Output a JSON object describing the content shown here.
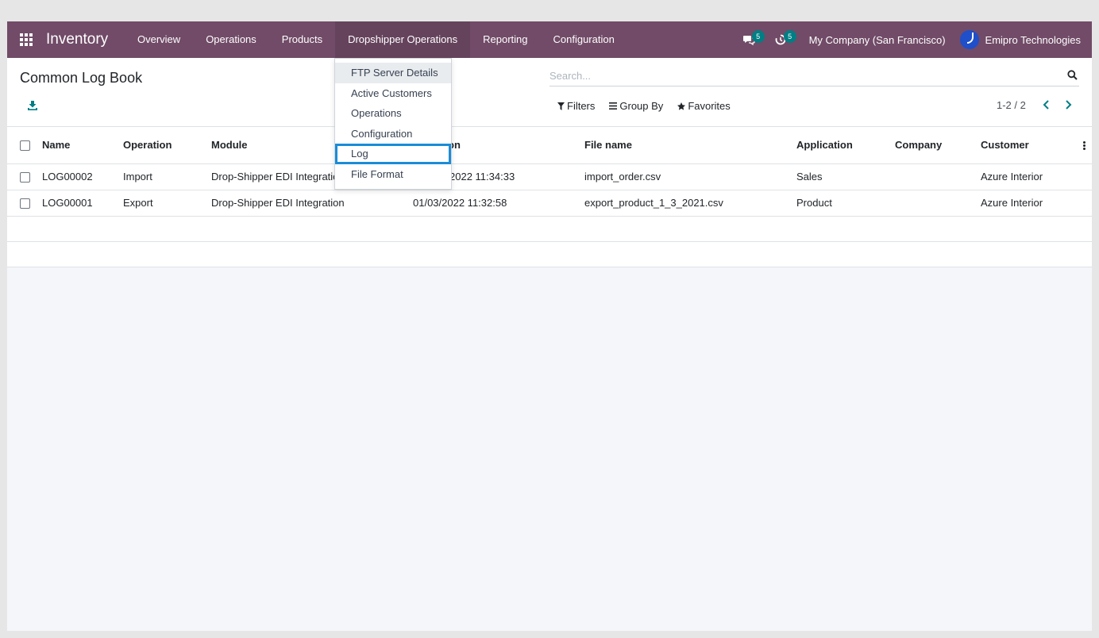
{
  "navbar": {
    "app_title": "Inventory",
    "menu": [
      "Overview",
      "Operations",
      "Products",
      "Dropshipper Operations",
      "Reporting",
      "Configuration"
    ],
    "active_menu": "Dropshipper Operations",
    "messages_count": "5",
    "activities_count": "5",
    "company": "My Company (San Francisco)",
    "user": "Emipro Technologies"
  },
  "control_panel": {
    "title": "Common Log Book",
    "search_placeholder": "Search...",
    "filters_label": "Filters",
    "group_by_label": "Group By",
    "favorites_label": "Favorites",
    "pager": "1-2 / 2"
  },
  "table": {
    "columns": {
      "name": "Name",
      "operation": "Operation",
      "module": "Module",
      "date_partial": "on",
      "file_name": "File name",
      "application": "Application",
      "company": "Company",
      "customer": "Customer"
    },
    "rows": [
      {
        "name": "LOG00002",
        "operation": "Import",
        "module": "Drop-Shipper EDI Integratio",
        "date": "2022 11:34:33",
        "file_name": "import_order.csv",
        "application": "Sales",
        "company": "",
        "customer": "Azure Interior"
      },
      {
        "name": "LOG00001",
        "operation": "Export",
        "module": "Drop-Shipper EDI Integration",
        "date": "01/03/2022 11:32:58",
        "file_name": "export_product_1_3_2021.csv",
        "application": "Product",
        "company": "",
        "customer": "Azure Interior"
      }
    ]
  },
  "dropdown": {
    "items": [
      "FTP Server Details",
      "Active Customers",
      "Operations",
      "Configuration",
      "Log",
      "File Format"
    ],
    "hovered_item": "FTP Server Details",
    "highlighted_item": "Log"
  },
  "colors": {
    "navbar": "#714b67",
    "accent": "#017e84",
    "highlight_border": "#1a8cd8"
  }
}
